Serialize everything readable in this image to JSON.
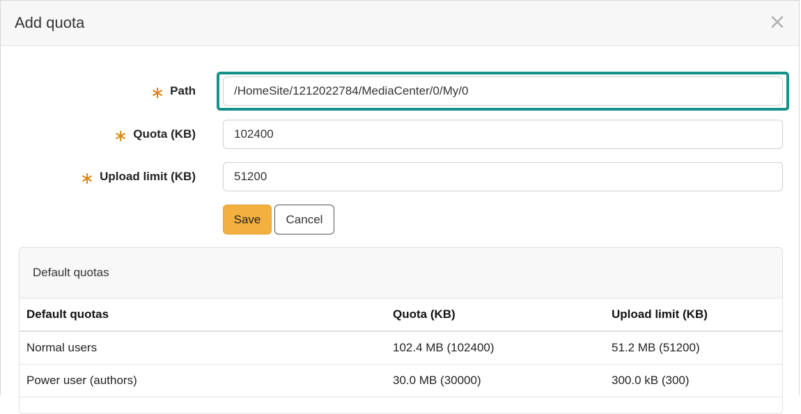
{
  "dialog": {
    "title": "Add quota",
    "close_glyph": "×"
  },
  "form": {
    "required_marker": "∗",
    "path": {
      "label": "Path",
      "value": "/HomeSite/1212022784/MediaCenter/0/My/0"
    },
    "quota": {
      "label": "Quota (KB)",
      "value": "102400"
    },
    "upload_limit": {
      "label": "Upload limit (KB)",
      "value": "51200"
    },
    "save_label": "Save",
    "cancel_label": "Cancel"
  },
  "default_quotas": {
    "panel_title": "Default quotas",
    "columns": [
      "Default quotas",
      "Quota (KB)",
      "Upload limit (KB)"
    ],
    "rows": [
      [
        "Normal users",
        "102.4 MB (102400)",
        "51.2 MB (51200)"
      ],
      [
        "Power user (authors)",
        "30.0 MB (30000)",
        "300.0 kB (300)"
      ]
    ]
  },
  "colors": {
    "accent_highlight": "#17918c",
    "save_button": "#f4b03e",
    "required_marker": "#d9850a"
  }
}
